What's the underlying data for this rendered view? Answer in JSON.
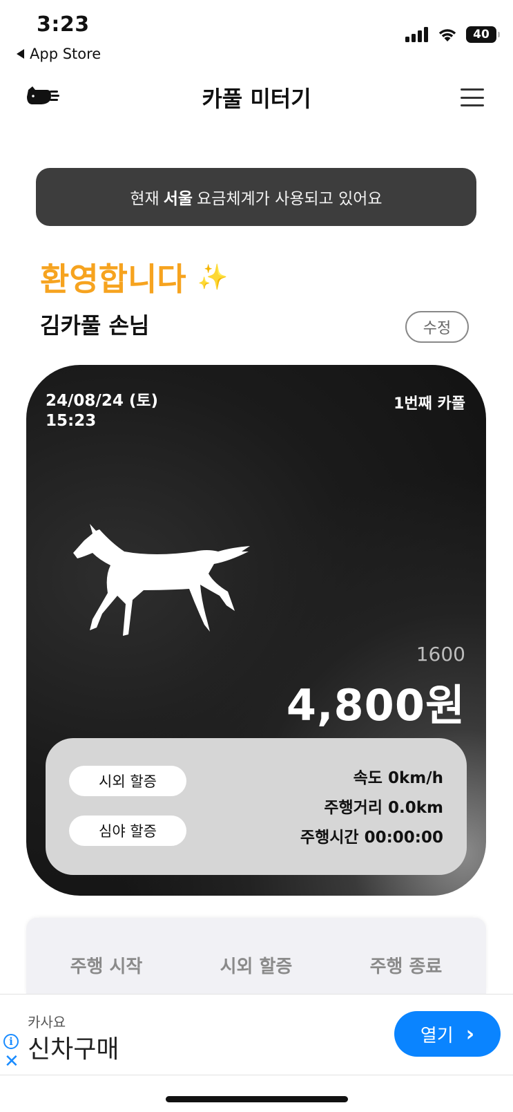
{
  "status_bar": {
    "time": "3:23",
    "back_label": "App Store",
    "battery": "40"
  },
  "header": {
    "title": "카풀 미터기",
    "logo_icon": "fast-cat-icon",
    "menu_icon": "hamburger-menu-icon"
  },
  "banner": {
    "prefix": "현재",
    "region": "서울",
    "suffix": "요금체계가 사용되고 있어요"
  },
  "welcome": {
    "greeting": "환영합니다",
    "sparkle": "✨",
    "user": "김카풀 손님",
    "edit_label": "수정"
  },
  "card": {
    "date": "24/08/24 (토)",
    "time": "15:23",
    "carpool_count": "1번째 카풀",
    "fare_unit": "1600",
    "fare": "4,800원",
    "surcharge_outside": "시외 할증",
    "surcharge_night": "심야 할증",
    "speed": "속도 0km/h",
    "distance": "주행거리 0.0km",
    "duration": "주행시간 00:00:00"
  },
  "actions": {
    "start": "주행 시작",
    "outside": "시외 할증",
    "end": "주행 종료"
  },
  "ad": {
    "sponsor": "카사요",
    "title": "신차구매",
    "open_label": "열기",
    "info_symbol": "i",
    "close_symbol": "✕"
  },
  "colors": {
    "accent_orange": "#f6a31f",
    "ad_blue": "#0a84ff",
    "banner_bg": "#3d3d3d"
  }
}
